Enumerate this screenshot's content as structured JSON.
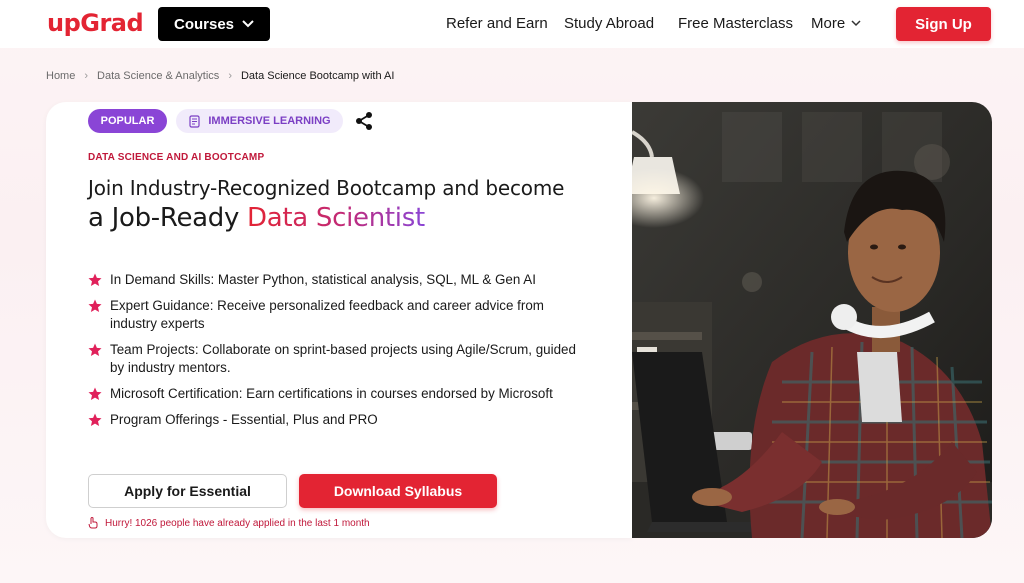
{
  "brand": {
    "logo_text": "upGrad",
    "accent_color": "#e32433"
  },
  "nav": {
    "courses_label": "Courses",
    "links": [
      "Refer and Earn",
      "Study Abroad",
      "Free Masterclass"
    ],
    "more_label": "More",
    "signup_label": "Sign Up"
  },
  "breadcrumb": {
    "items": [
      "Home",
      "Data Science & Analytics"
    ],
    "current": "Data Science Bootcamp with AI"
  },
  "hero": {
    "badges": {
      "popular": "POPULAR",
      "immersive": "IMMERSIVE LEARNING"
    },
    "eyebrow": "DATA SCIENCE AND AI BOOTCAMP",
    "title_line1": "Join Industry-Recognized Bootcamp and become",
    "title_line2_prefix": "a Job-Ready ",
    "title_line2_accent": "Data Scientist",
    "features": [
      "In Demand Skills: Master Python, statistical analysis, SQL, ML & Gen AI",
      "Expert Guidance: Receive personalized feedback and career advice from industry experts",
      "Team Projects: Collaborate on sprint-based projects using Agile/Scrum, guided by industry mentors.",
      "Microsoft Certification: Earn certifications in courses endorsed by Microsoft",
      "Program Offerings - Essential, Plus and PRO"
    ],
    "apply_label": "Apply for Essential",
    "download_label": "Download Syllabus",
    "hurry_text": "Hurry! 1026 people have already applied in the last 1 month"
  },
  "icons": {
    "courses_chevron": "chevron-down-icon",
    "more_chevron": "chevron-down-icon",
    "breadcrumb_separator": "chevron-right-icon",
    "immersive": "notebook-icon",
    "share": "share-icon",
    "feature_bullet": "star-icon",
    "hurry": "hand-pointer-icon"
  }
}
